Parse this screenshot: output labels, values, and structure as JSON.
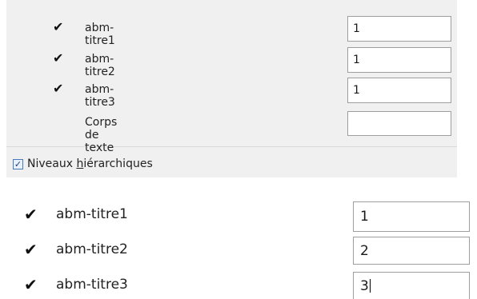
{
  "top_panel": {
    "rows": [
      {
        "checked": true,
        "label": "abm-titre1",
        "value": "1"
      },
      {
        "checked": true,
        "label": "abm-titre2",
        "value": "1"
      },
      {
        "checked": true,
        "label": "abm-titre3",
        "value": "1"
      },
      {
        "checked": false,
        "label": "Corps de texte",
        "value": ""
      }
    ],
    "checkbox": {
      "checked": true,
      "label_prefix": "Niveaux ",
      "label_accel": "h",
      "label_suffix": "iérarchiques"
    }
  },
  "bottom_panel": {
    "rows": [
      {
        "checked": true,
        "label": "abm-titre1",
        "value": "1"
      },
      {
        "checked": true,
        "label": "abm-titre2",
        "value": "2"
      },
      {
        "checked": true,
        "label": "abm-titre3",
        "value": "3"
      }
    ]
  },
  "icons": {
    "check": "✔",
    "checkbox_mark": "✓"
  }
}
